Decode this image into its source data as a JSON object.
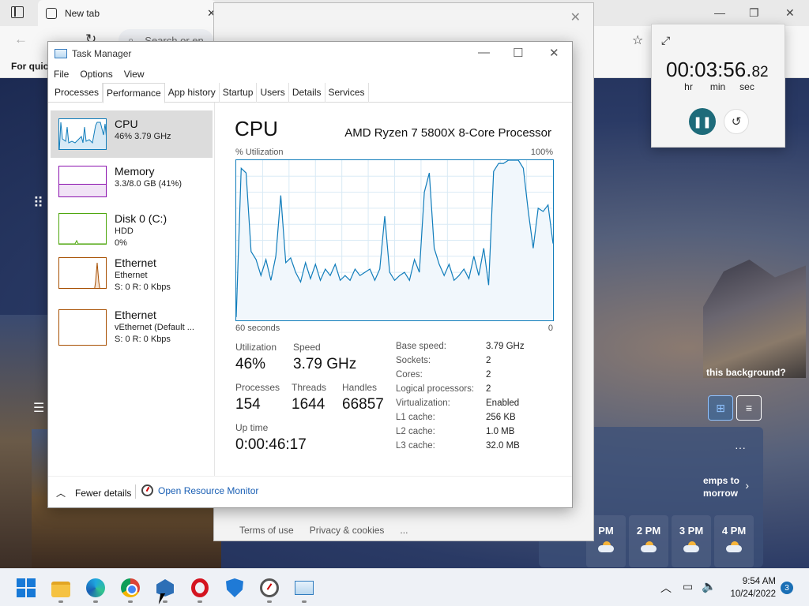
{
  "edge": {
    "tab_label": "New tab",
    "search_placeholder": "Search or en",
    "favbar_text": "For quic",
    "bg_question": "this background?",
    "weather_message": "emps to",
    "weather_message2": "morrow",
    "hours": [
      "PM",
      "2 PM",
      "3 PM",
      "4 PM"
    ]
  },
  "bgdialog": {
    "footer": [
      "Terms of use",
      "Privacy & cookies",
      "..."
    ]
  },
  "taskmgr": {
    "title": "Task Manager",
    "menu": [
      "File",
      "Options",
      "View"
    ],
    "tabs": [
      "Processes",
      "Performance",
      "App history",
      "Startup",
      "Users",
      "Details",
      "Services"
    ],
    "active_tab": "Performance",
    "sidebar": [
      {
        "name": "CPU",
        "line1": "46%  3.79 GHz",
        "line2": ""
      },
      {
        "name": "Memory",
        "line1": "3.3/8.0 GB (41%)",
        "line2": ""
      },
      {
        "name": "Disk 0 (C:)",
        "line1": "HDD",
        "line2": "0%"
      },
      {
        "name": "Ethernet",
        "line1": "Ethernet",
        "line2": "S: 0  R: 0 Kbps"
      },
      {
        "name": "Ethernet",
        "line1": "vEthernet (Default ...",
        "line2": "S: 0  R: 0 Kbps"
      }
    ],
    "cpu": {
      "title": "CPU",
      "model": "AMD Ryzen 7 5800X 8-Core Processor",
      "util_label": "% Utilization",
      "util_max": "100%",
      "x_left": "60 seconds",
      "x_right": "0",
      "stats": {
        "utilization_label": "Utilization",
        "utilization": "46%",
        "speed_label": "Speed",
        "speed": "3.79 GHz",
        "processes_label": "Processes",
        "processes": "154",
        "threads_label": "Threads",
        "threads": "1644",
        "handles_label": "Handles",
        "handles": "66857",
        "uptime_label": "Up time",
        "uptime": "0:00:46:17"
      },
      "details": [
        [
          "Base speed:",
          "3.79 GHz"
        ],
        [
          "Sockets:",
          "2"
        ],
        [
          "Cores:",
          "2"
        ],
        [
          "Logical processors:",
          "2"
        ],
        [
          "Virtualization:",
          "Enabled"
        ],
        [
          "L1 cache:",
          "256 KB"
        ],
        [
          "L2 cache:",
          "1.0 MB"
        ],
        [
          "L3 cache:",
          "32.0 MB"
        ]
      ]
    },
    "fewer_details": "Fewer details",
    "open_resmon": "Open Resource Monitor"
  },
  "chart_data": {
    "type": "area",
    "ylabel": "% Utilization",
    "ylim": [
      0,
      100
    ],
    "xlim": [
      60,
      0
    ],
    "values": [
      2,
      95,
      92,
      43,
      38,
      28,
      38,
      25,
      40,
      78,
      36,
      39,
      30,
      24,
      36,
      26,
      35,
      25,
      32,
      28,
      35,
      25,
      28,
      25,
      32,
      28,
      30,
      32,
      25,
      32,
      65,
      30,
      25,
      28,
      30,
      25,
      38,
      30,
      80,
      92,
      45,
      35,
      28,
      35,
      25,
      28,
      32,
      26,
      40,
      28,
      45,
      22,
      93,
      98,
      98,
      100,
      100,
      100,
      95,
      68,
      45,
      70,
      68,
      72,
      48
    ]
  },
  "stopwatch": {
    "time": "00:03:56.",
    "hundredths": "82",
    "units": [
      "hr",
      "min",
      "sec"
    ]
  },
  "taskbar": {
    "clock_time": "9:54 AM",
    "clock_date": "10/24/2022",
    "badge": "3"
  }
}
